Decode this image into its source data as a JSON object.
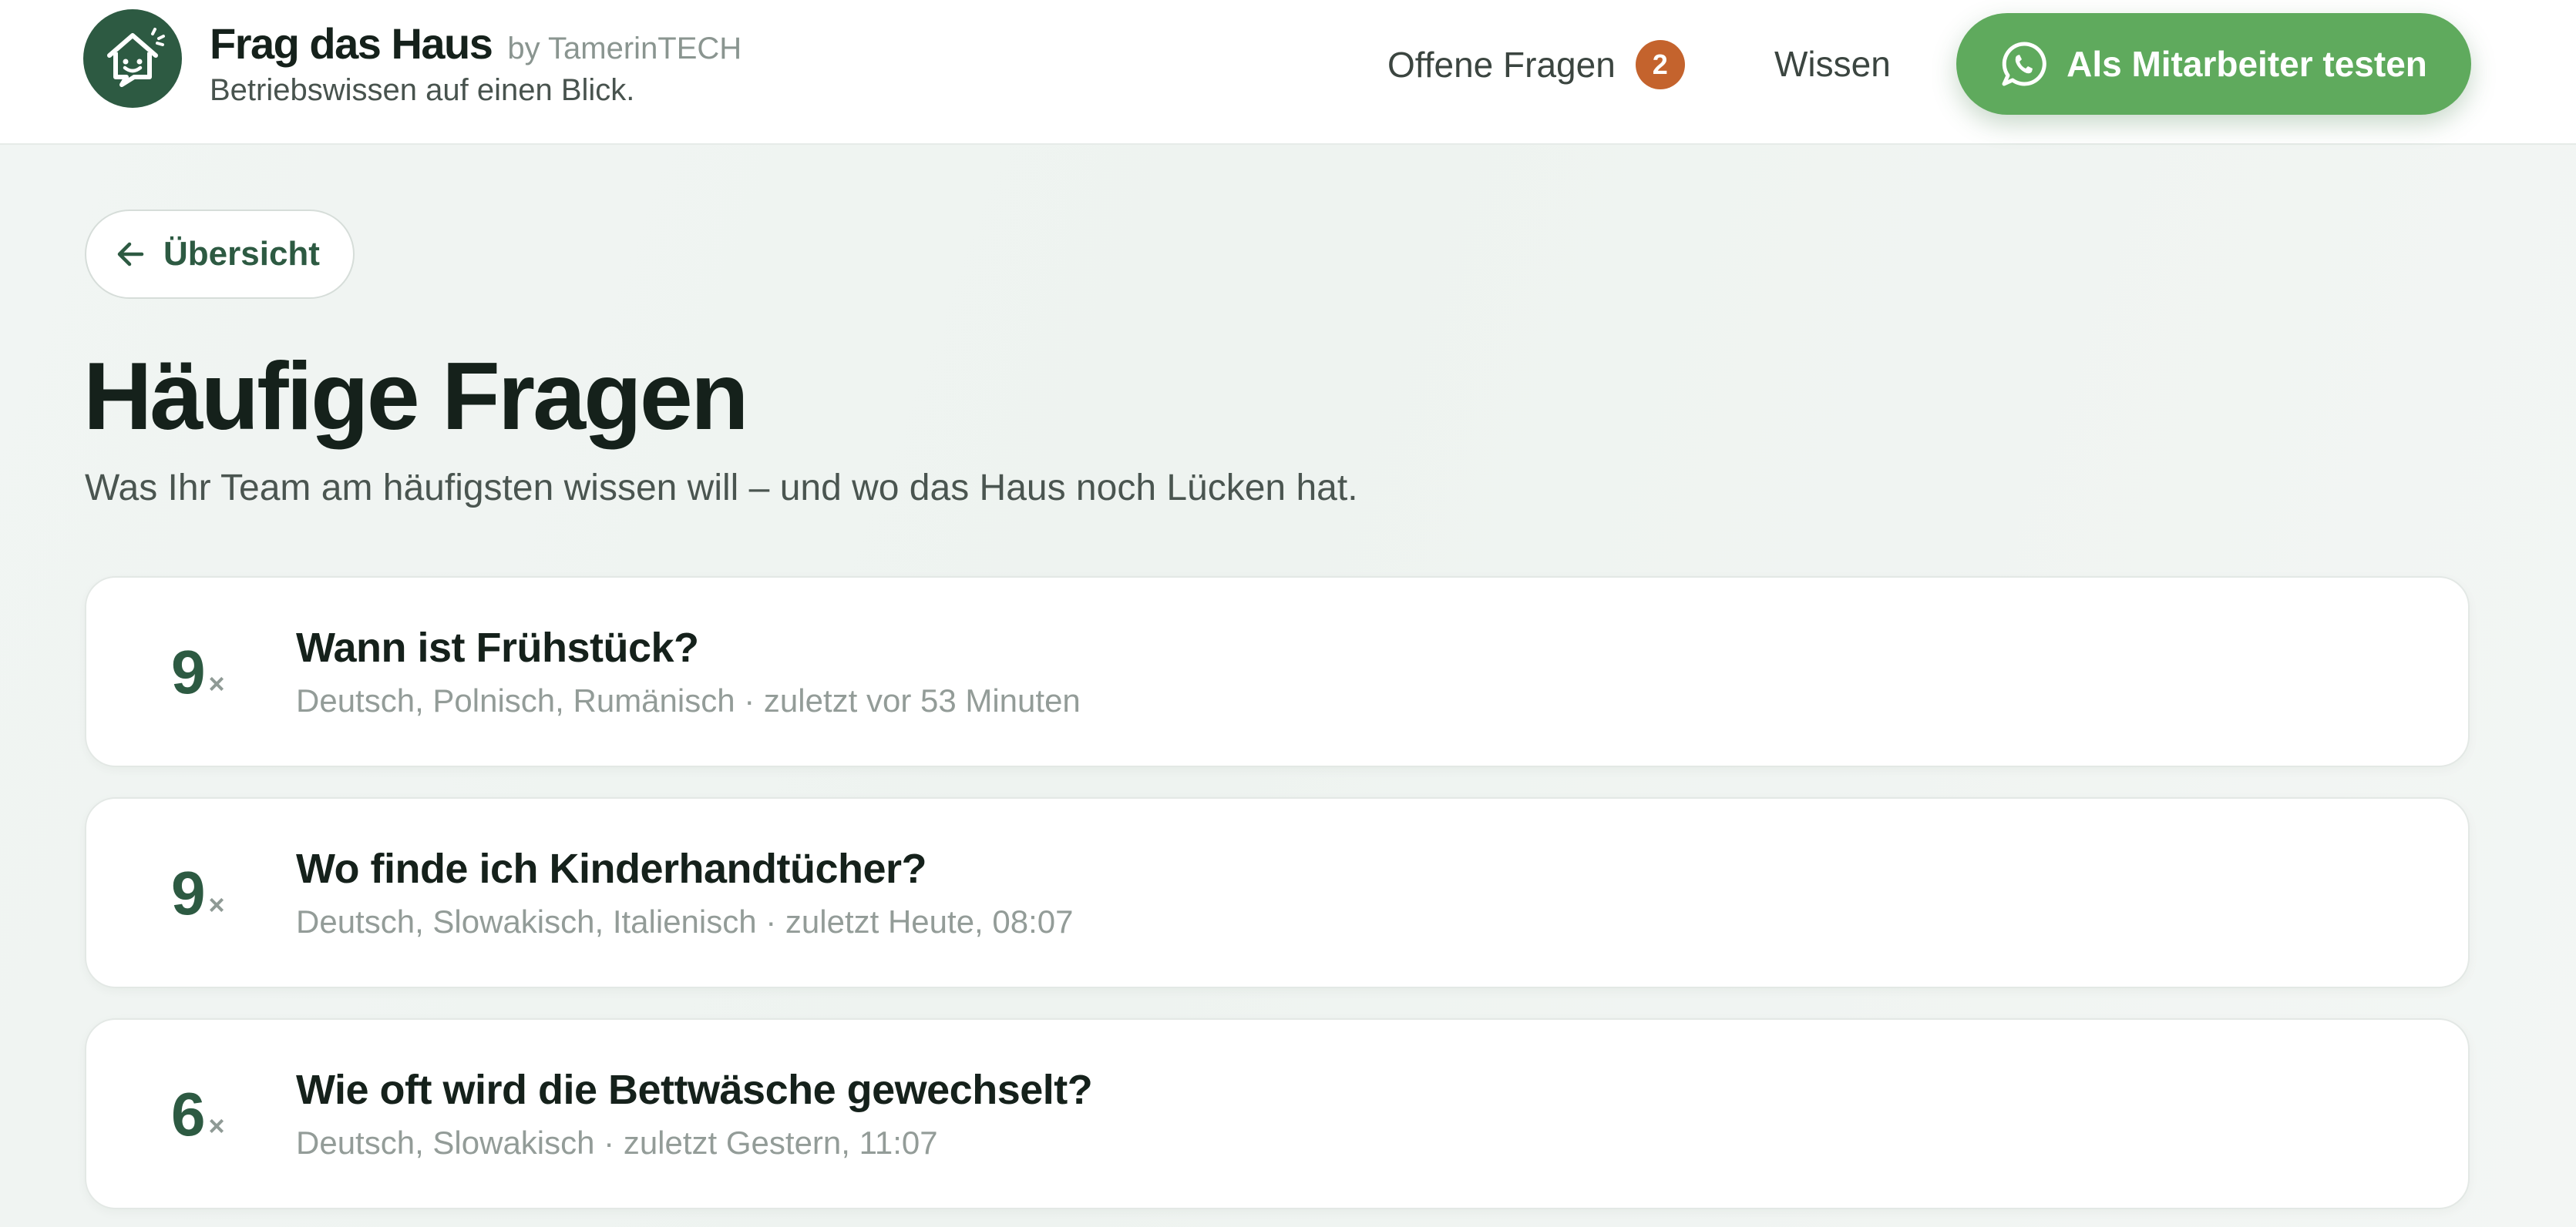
{
  "header": {
    "brand_name": "Frag das Haus",
    "brand_by": "by TamerinTECH",
    "tagline": "Betriebswissen auf einen Blick.",
    "logo_icon": "house-chat-icon",
    "nav": {
      "open_questions_label": "Offene Fragen",
      "open_questions_count": "2",
      "knowledge_label": "Wissen"
    },
    "cta": {
      "label": "Als Mitarbeiter testen",
      "icon": "whatsapp-icon"
    }
  },
  "back_button": {
    "label": "Übersicht",
    "icon": "arrow-left-icon"
  },
  "page": {
    "title": "Häufige Fragen",
    "subtitle": "Was Ihr Team am häufigsten wissen will – und wo das Haus noch Lücken hat."
  },
  "questions": [
    {
      "count": "9",
      "suffix": "×",
      "title": "Wann ist Frühstück?",
      "meta": "Deutsch, Polnisch, Rumänisch · zuletzt vor 53 Minuten"
    },
    {
      "count": "9",
      "suffix": "×",
      "title": "Wo finde ich Kinderhandtücher?",
      "meta": "Deutsch, Slowakisch, Italienisch · zuletzt Heute, 08:07"
    },
    {
      "count": "6",
      "suffix": "×",
      "title": "Wie oft wird die Bettwäsche gewechselt?",
      "meta": "Deutsch, Slowakisch · zuletzt Gestern, 11:07"
    }
  ],
  "colors": {
    "brand_green": "#2d5a42",
    "cta_green": "#5faa5d",
    "badge_orange": "#c4632d",
    "background": "#f0f4f2"
  }
}
